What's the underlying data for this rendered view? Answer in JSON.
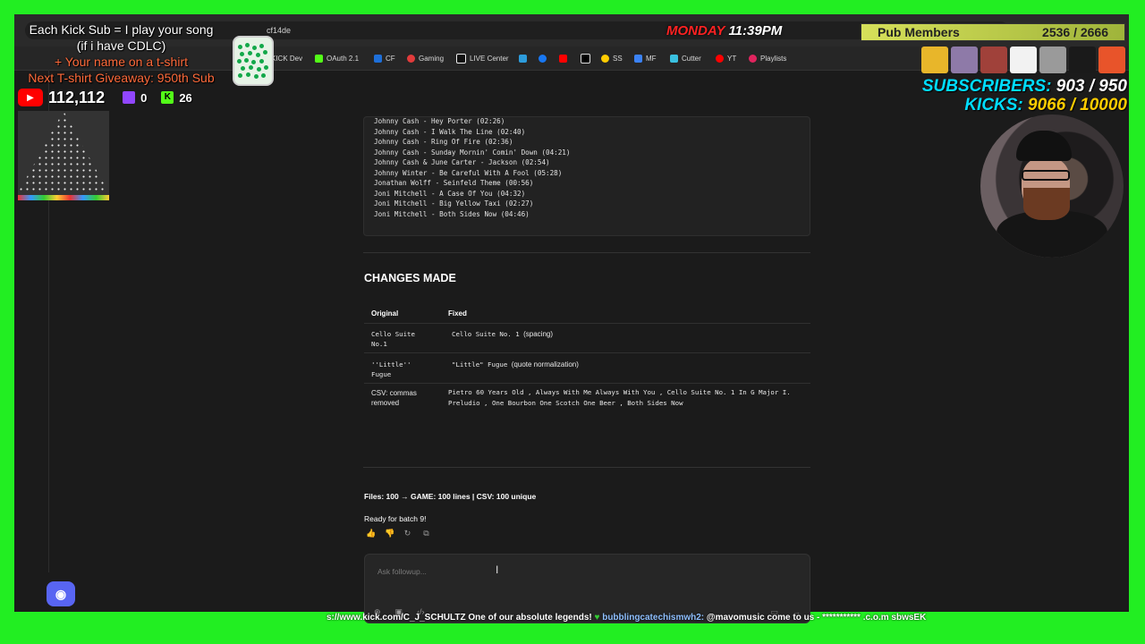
{
  "overlay": {
    "kick_sub_line": "Each Kick Sub = I play your song",
    "cdlc_line": "(if i have CDLC)",
    "tshirt_line": "+ Your name on a t-shirt",
    "giveaway_line": "Next T-shirt Giveaway: 950th Sub",
    "youtube_count": "112,112",
    "twitch_count": "0",
    "kick_count": "26",
    "clock_day": "MONDAY",
    "clock_time": "11:39PM",
    "pub_label": "Pub Members",
    "pub_count": "2536 / 2666",
    "subscribers_label": "SUBSCRIBERS:",
    "subscribers_value": "903 / 950",
    "kicks_label": "KICKS:",
    "kicks_value": "9066 / 10000",
    "ticker_a": "s://www.kick.com/C_J_SCHULTZ One of our absolute legends!",
    "ticker_b": "bubblingcatechismwh2:",
    "ticker_c": "@mavomusic come to us - *********** .c.o.m sbwsEK"
  },
  "browser": {
    "url_fragment": "cf14de",
    "bookmarks": [
      "KICK Dev",
      "OAuth 2.1",
      "CF",
      "Gaming",
      "LIVE Center",
      "SS",
      "MF",
      "Cutter",
      "YT",
      "Playlists"
    ]
  },
  "code": {
    "lines": [
      "Johnny Cash - Hey Porter (02:26)",
      "Johnny Cash - I Walk The Line (02:40)",
      "Johnny Cash - Ring Of Fire (02:36)",
      "Johnny Cash - Sunday Mornin' Comin' Down (04:21)",
      "Johnny Cash & June Carter - Jackson (02:54)",
      "Johnny Winter - Be Careful With A Fool (05:28)",
      "Jonathan Wolff - Seinfeld Theme (00:56)",
      "Joni Mitchell - A Case Of You (04:32)",
      "Joni Mitchell - Big Yellow Taxi (02:27)",
      "Joni Mitchell - Both Sides Now (04:46)"
    ]
  },
  "changes": {
    "heading": "CHANGES MADE",
    "col_original": "Original",
    "col_fixed": "Fixed",
    "rows": [
      {
        "original": "Cello Suite No.1",
        "fixed_code": "Cello Suite No. 1",
        "fixed_note": "(spacing)"
      },
      {
        "original": "''Little'' Fugue",
        "fixed_code": "\"Little\" Fugue",
        "fixed_note": "(quote normalization)"
      },
      {
        "original": "CSV: commas removed",
        "fixed_code": "Pietro 60 Years Old , Always With Me Always With You , Cello Suite No. 1 In G Major I. Preludio , One Bourbon One Scotch One Beer , Both Sides Now",
        "fixed_note": ""
      }
    ]
  },
  "summary": {
    "files_line": "Files: 100 → GAME: 100 lines | CSV: 100 unique",
    "ready_line": "Ready for batch 9!"
  },
  "composer": {
    "placeholder": "Ask followup..."
  }
}
